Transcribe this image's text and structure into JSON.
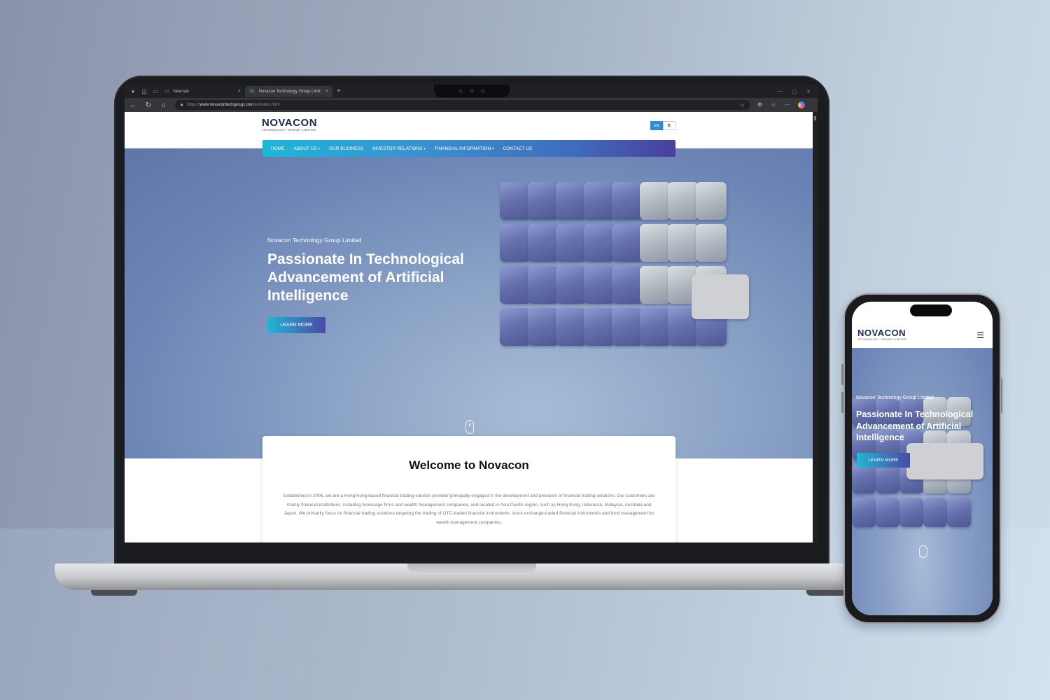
{
  "browser": {
    "tabs": [
      {
        "label": "New tab",
        "close": "×"
      },
      {
        "label": "Novacon Technology Group Limit",
        "favicon": "VA",
        "close": "×"
      }
    ],
    "new_tab": "+",
    "url_scheme": "https://",
    "url_host": "www.novacontechgroup.com",
    "url_path": "/en/index.html"
  },
  "site": {
    "logo": "NOVACON",
    "logo_sub": "TECHNOLOGY GROUP LIMITED",
    "lang": {
      "en": "EN",
      "tc": "繁"
    },
    "nav": [
      {
        "label": "HOME",
        "caret": ""
      },
      {
        "label": "ABOUT US",
        "caret": "▾"
      },
      {
        "label": "OUR BUSINESS",
        "caret": ""
      },
      {
        "label": "INVESTOR RELATIONS",
        "caret": "▾"
      },
      {
        "label": "FINANCIAL INFORMATION",
        "caret": "▾"
      },
      {
        "label": "CONTACT US",
        "caret": ""
      }
    ],
    "hero": {
      "subtitle": "Novacon Technology Group Limited",
      "title": "Passionate In Technological Advancement of Artificial Intelligence",
      "cta": "LEARN MORE"
    },
    "welcome": {
      "title": "Welcome to Novacon",
      "body": "Established in 2006, we are a Hong Kong-based financial trading solution provider principally engaged in the development and provision of financial trading solutions. Our customers are mainly financial institutions, including brokerage firms and wealth management companies, and located in Asia Pacific region, such as Hong Kong, Indonesia, Malaysia, Australia and Japan. We primarily focus on financial trading solutions targeting the trading of OTC-traded financial instruments, stock exchange-traded financial instruments and fund management for wealth management companies."
    }
  },
  "mobile": {
    "menu_icon": "☰"
  },
  "colors": {
    "nav_gradient_start": "#1fb6d6",
    "nav_gradient_end": "#4b3f9c",
    "lang_active": "#2a8fd6",
    "logo": "#1d2b4f"
  }
}
